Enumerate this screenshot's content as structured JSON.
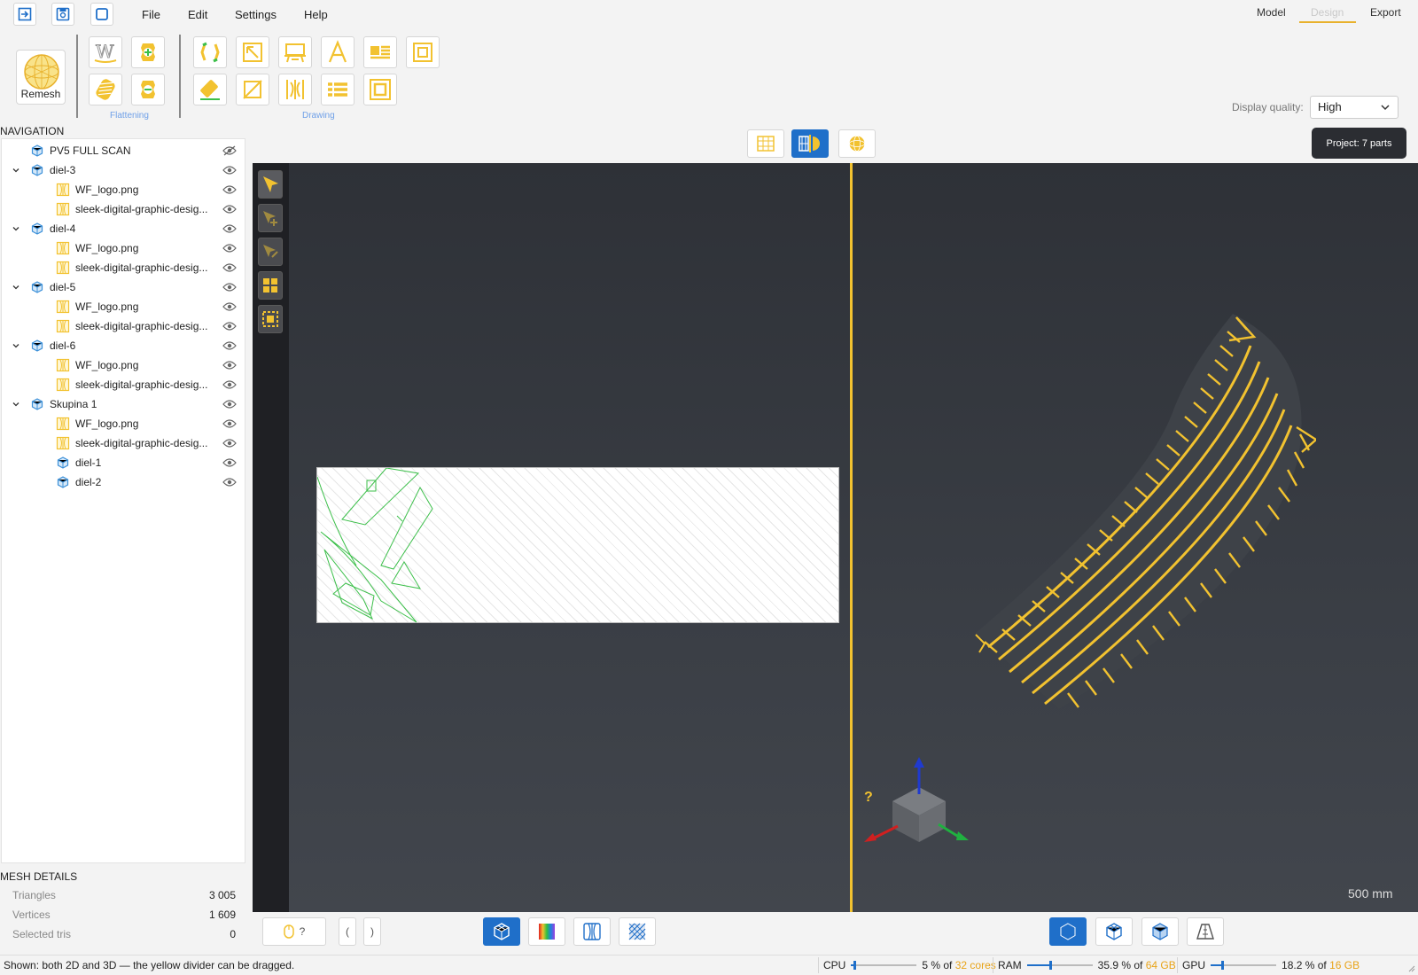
{
  "menu": {
    "file": "File",
    "edit": "Edit",
    "settings": "Settings",
    "help": "Help"
  },
  "modes": {
    "model": "Model",
    "design": "Design",
    "export": "Export"
  },
  "ribbon": {
    "remesh_label": "Remesh",
    "flattening_label": "Flattening",
    "drawing_label": "Drawing"
  },
  "display_quality": {
    "label": "Display quality:",
    "value": "High"
  },
  "navigation": {
    "title": "NAVIGATION",
    "items": [
      {
        "label": "PV5 FULL SCAN",
        "type": "mesh",
        "depth": 0,
        "expander": false,
        "visible": false
      },
      {
        "label": "diel-3",
        "type": "mesh",
        "depth": 0,
        "expander": true,
        "visible": true
      },
      {
        "label": "WF_logo.png",
        "type": "image",
        "depth": 1,
        "expander": false,
        "visible": true
      },
      {
        "label": "sleek-digital-graphic-desig...",
        "type": "image",
        "depth": 1,
        "expander": false,
        "visible": true
      },
      {
        "label": "diel-4",
        "type": "mesh",
        "depth": 0,
        "expander": true,
        "visible": true
      },
      {
        "label": "WF_logo.png",
        "type": "image",
        "depth": 1,
        "expander": false,
        "visible": true
      },
      {
        "label": "sleek-digital-graphic-desig...",
        "type": "image",
        "depth": 1,
        "expander": false,
        "visible": true
      },
      {
        "label": "diel-5",
        "type": "mesh",
        "depth": 0,
        "expander": true,
        "visible": true
      },
      {
        "label": "WF_logo.png",
        "type": "image",
        "depth": 1,
        "expander": false,
        "visible": true
      },
      {
        "label": "sleek-digital-graphic-desig...",
        "type": "image",
        "depth": 1,
        "expander": false,
        "visible": true
      },
      {
        "label": "diel-6",
        "type": "mesh",
        "depth": 0,
        "expander": true,
        "visible": true
      },
      {
        "label": "WF_logo.png",
        "type": "image",
        "depth": 1,
        "expander": false,
        "visible": true
      },
      {
        "label": "sleek-digital-graphic-desig...",
        "type": "image",
        "depth": 1,
        "expander": false,
        "visible": true
      },
      {
        "label": "Skupina 1",
        "type": "mesh",
        "depth": 0,
        "expander": true,
        "visible": true
      },
      {
        "label": "WF_logo.png",
        "type": "image",
        "depth": 1,
        "expander": false,
        "visible": true
      },
      {
        "label": "sleek-digital-graphic-desig...",
        "type": "image",
        "depth": 1,
        "expander": false,
        "visible": true
      },
      {
        "label": "diel-1",
        "type": "mesh",
        "depth": 1,
        "expander": false,
        "visible": true
      },
      {
        "label": "diel-2",
        "type": "mesh",
        "depth": 1,
        "expander": false,
        "visible": true
      }
    ]
  },
  "mesh_details": {
    "title": "MESH DETAILS",
    "rows": [
      {
        "key": "Triangles",
        "value": "3 005"
      },
      {
        "key": "Vertices",
        "value": "1 609"
      },
      {
        "key": "Selected tris",
        "value": "0"
      }
    ]
  },
  "project_badge": "Project: 7 parts",
  "viewport": {
    "scale_label": "500 mm",
    "help_marker": "?"
  },
  "bottom": {
    "mouse_hint": "?",
    "bracket_left": "(",
    "bracket_right": ")"
  },
  "status": {
    "text": "Shown: both 2D and 3D — the yellow divider can be dragged.",
    "cpu": {
      "label": "CPU",
      "value": "5 % of",
      "total": "32 cores",
      "fraction": 0.05
    },
    "ram": {
      "label": "RAM",
      "value": "35.9 % of",
      "total": "64 GB",
      "fraction": 0.359
    },
    "gpu": {
      "label": "GPU",
      "value": "18.2 % of",
      "total": "16 GB",
      "fraction": 0.182
    }
  },
  "colors": {
    "accent": "#1f6fc9",
    "tool_yellow": "#f2c230",
    "divider": "#f2c230",
    "mesh_blue": "#3a8fd8",
    "outline_green": "#3cbf4a"
  }
}
